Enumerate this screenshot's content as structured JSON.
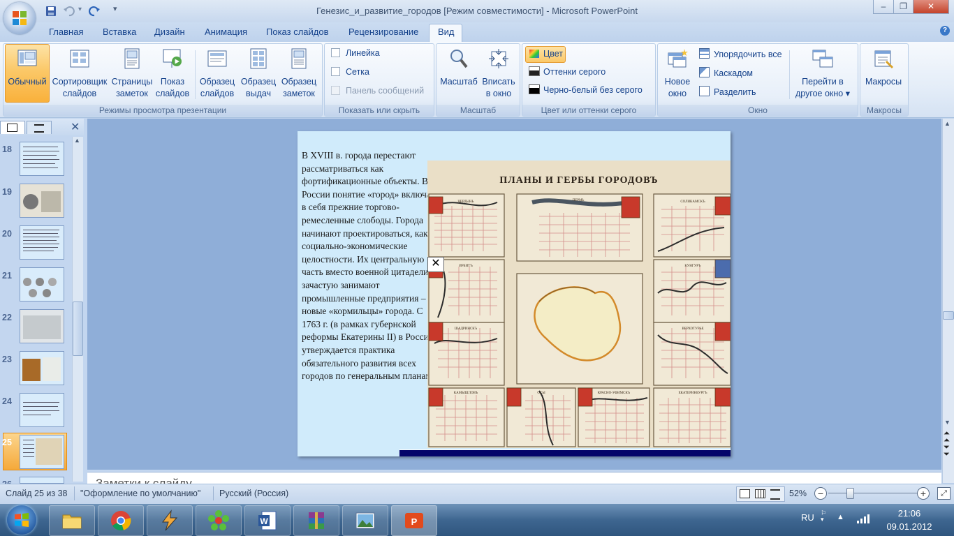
{
  "window": {
    "title": "Генезис_и_развитие_городов [Режим совместимости] - Microsoft PowerPoint",
    "minimize": "–",
    "restore": "❐",
    "close": "✕"
  },
  "tabs": [
    "Главная",
    "Вставка",
    "Дизайн",
    "Анимация",
    "Показ слайдов",
    "Рецензирование",
    "Вид"
  ],
  "ribbon": {
    "views": {
      "label": "Режимы просмотра презентации",
      "buttons": [
        {
          "line1": "Обычный",
          "line2": ""
        },
        {
          "line1": "Сортировщик",
          "line2": "слайдов"
        },
        {
          "line1": "Страницы",
          "line2": "заметок"
        },
        {
          "line1": "Показ",
          "line2": "слайдов"
        },
        {
          "line1": "Образец",
          "line2": "слайдов"
        },
        {
          "line1": "Образец",
          "line2": "выдач"
        },
        {
          "line1": "Образец",
          "line2": "заметок"
        }
      ]
    },
    "show_hide": {
      "label": "Показать или скрыть",
      "items": [
        "Линейка",
        "Сетка",
        "Панель сообщений"
      ]
    },
    "zoom": {
      "label": "Масштаб",
      "buttons": [
        {
          "line1": "Масштаб",
          "line2": ""
        },
        {
          "line1": "Вписать",
          "line2": "в окно"
        }
      ]
    },
    "color": {
      "label": "Цвет или оттенки серого",
      "items": [
        "Цвет",
        "Оттенки серого",
        "Черно-белый без серого"
      ]
    },
    "window": {
      "label": "Окно",
      "new_window": {
        "line1": "Новое",
        "line2": "окно"
      },
      "items": [
        "Упорядочить все",
        "Каскадом",
        "Разделить"
      ],
      "switch": {
        "line1": "Перейти в",
        "line2": "другое окно ▾"
      }
    },
    "macros": {
      "label": "Макросы",
      "button": "Макросы"
    }
  },
  "thumbnails": [
    {
      "num": "18"
    },
    {
      "num": "19"
    },
    {
      "num": "20"
    },
    {
      "num": "21"
    },
    {
      "num": "22"
    },
    {
      "num": "23"
    },
    {
      "num": "24"
    },
    {
      "num": "25"
    },
    {
      "num": "26"
    }
  ],
  "slide": {
    "text": "В XVIII в. города перестают рассматриваться как фортификационные объекты. В России понятие «город» включает в себя прежние торгово-ремесленные слободы. Города начинают проектироваться, как социально-экономические целостности. Их центральную часть вместо военной цитадели зачастую занимают промышленные предприятия – новые «кормильцы» города. С 1763 г. (в рамках губернской реформы Екатерины II) в России утверждается практика обязательного развития всех городов по генеральным планам.",
    "map_title": "ПЛАНЫ И ГЕРБЫ ГОРОДОВЪ",
    "map_labels": [
      "ЧЕРДЫНЬ",
      "ПЕРМЬ",
      "СОЛИКАМСКЪ",
      "ИРБИТЪ",
      "КУНГУРЪ",
      "ШАДРИНСКЪ",
      "ВЕРХОТУРЬЕ",
      "КАМЫШЛОВЪ",
      "ОСЫ",
      "КРАСНО-УФИМСКЪ",
      "ЕКАТЕРИНБУРГЪ"
    ]
  },
  "notes": {
    "text": "Заметки к слайду"
  },
  "status": {
    "slide": "Слайд 25 из 38",
    "theme": "\"Оформление по умолчанию\"",
    "language": "Русский (Россия)",
    "zoom": "52%"
  },
  "tray": {
    "lang": "RU",
    "time": "21:06",
    "date": "09.01.2012"
  }
}
